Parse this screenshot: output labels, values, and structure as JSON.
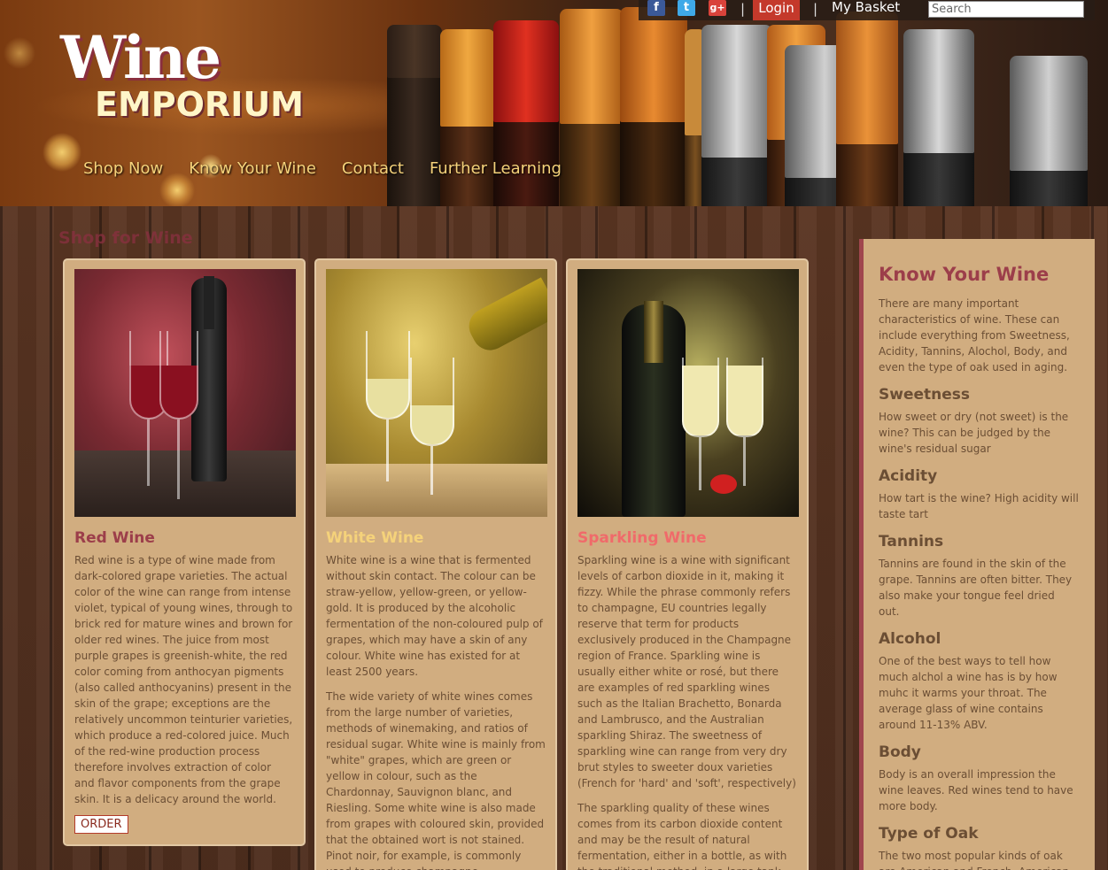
{
  "header": {
    "logo_top": "Wine",
    "logo_bottom": "EMPORIUM",
    "nav": [
      "Shop Now",
      "Know Your Wine",
      "Contact",
      "Further Learning"
    ],
    "social": [
      "f",
      "t",
      "g+"
    ],
    "login_label": "Login",
    "basket_label": "My Basket",
    "search_placeholder": "Search"
  },
  "main": {
    "section_title": "Shop for Wine",
    "cards": [
      {
        "title": "Red Wine",
        "title_color": "#9c3e4a",
        "paragraphs": [
          "Red wine is a type of wine made from dark-colored grape varieties. The actual color of the wine can range from intense violet, typical of young wines, through to brick red for mature wines and brown for older red wines. The juice from most purple grapes is greenish-white, the red color coming from anthocyan pigments (also called anthocyanins) present in the skin of the grape; exceptions are the relatively uncommon teinturier varieties, which produce a red-colored juice. Much of the red-wine production process therefore involves extraction of color and flavor components from the grape skin. It is a delicacy around the world."
        ],
        "button": "ORDER"
      },
      {
        "title": "White Wine",
        "title_color": "#f5d27a",
        "paragraphs": [
          "White wine is a wine that is fermented without skin contact. The colour can be straw-yellow, yellow-green, or yellow-gold. It is produced by the alcoholic fermentation of the non-coloured pulp of grapes, which may have a skin of any colour. White wine has existed for at least 2500 years.",
          "The wide variety of white wines comes from the large number of varieties, methods of winemaking, and ratios of residual sugar. White wine is mainly from \"white\" grapes, which are green or yellow in colour, such as the Chardonnay, Sauvignon blanc, and Riesling. Some white wine is also made from grapes with coloured skin, provided that the obtained wort is not stained. Pinot noir, for example, is commonly used to produce champagne."
        ]
      },
      {
        "title": "Sparkling Wine",
        "title_color": "#f06a6a",
        "paragraphs": [
          "Sparkling wine is a wine with significant levels of carbon dioxide in it, making it fizzy. While the phrase commonly refers to champagne, EU countries legally reserve that term for products exclusively produced in the Champagne region of France. Sparkling wine is usually either white or rosé, but there are examples of red sparkling wines such as the Italian Brachetto, Bonarda and Lambrusco, and the Australian sparkling Shiraz. The sweetness of sparkling wine can range from very dry brut styles to sweeter doux varieties (French for 'hard' and 'soft', respectively)",
          "The sparkling quality of these wines comes from its carbon dioxide content and may be the result of natural fermentation, either in a bottle, as with the traditional method, in a large tank"
        ]
      }
    ]
  },
  "sidebar": {
    "title": "Know Your Wine",
    "intro": "There are many important characteristics of wine. These can include everything from Sweetness, Acidity, Tannins, Alochol, Body, and even the type of oak used in aging.",
    "sections": [
      {
        "heading": "Sweetness",
        "text": "How sweet or dry (not sweet) is the wine? This can be judged by the wine's residual sugar"
      },
      {
        "heading": "Acidity",
        "text": "How tart is the wine? High acidity will taste tart"
      },
      {
        "heading": "Tannins",
        "text": "Tannins are found in the skin of the grape. Tannins are often bitter. They also make your tongue feel dried out."
      },
      {
        "heading": "Alcohol",
        "text": "One of the best ways to tell how much alchol a wine has is by how muhc it warms your throat. The average glass of wine contains around 11-13% ABV."
      },
      {
        "heading": "Body",
        "text": "Body is an overall impression the wine leaves. Red wines tend to have more body."
      },
      {
        "heading": "Type of Oak",
        "text": "The two most popular kinds of oak are American and French. American oak tends to leave more flavors of vanilla"
      }
    ]
  }
}
